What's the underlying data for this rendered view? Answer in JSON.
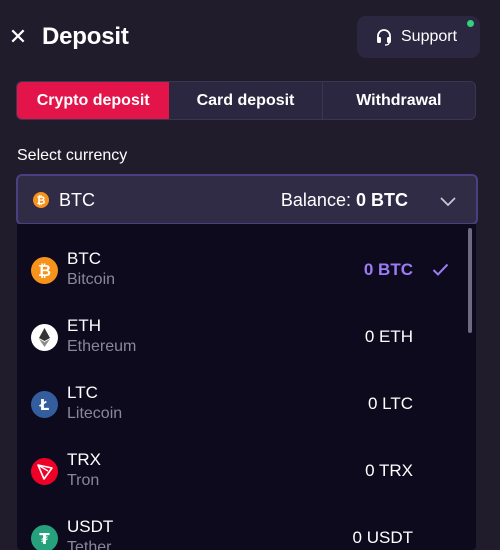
{
  "header": {
    "title": "Deposit",
    "close_icon": "close-icon",
    "support_label": "Support",
    "support_icon": "headset-icon",
    "online_status_color": "#32d17d"
  },
  "tabs": [
    {
      "label": "Crypto deposit",
      "active": true
    },
    {
      "label": "Card deposit",
      "active": false
    },
    {
      "label": "Withdrawal",
      "active": false
    }
  ],
  "currency_select": {
    "label": "Select currency",
    "selected_code": "BTC",
    "balance_label": "Balance:",
    "balance_value": "0 BTC",
    "chevron_icon": "chevron-down-icon"
  },
  "currencies": [
    {
      "code": "BTC",
      "name": "Bitcoin",
      "amount": "0 BTC",
      "selected": true,
      "color": "#f7931a"
    },
    {
      "code": "ETH",
      "name": "Ethereum",
      "amount": "0 ETH",
      "selected": false,
      "color": "#ffffff"
    },
    {
      "code": "LTC",
      "name": "Litecoin",
      "amount": "0 LTC",
      "selected": false,
      "color": "#345d9d"
    },
    {
      "code": "TRX",
      "name": "Tron",
      "amount": "0 TRX",
      "selected": false,
      "color": "#ef0027"
    },
    {
      "code": "USDT",
      "name": "Tether",
      "amount": "0 USDT",
      "selected": false,
      "color": "#26a17b"
    }
  ],
  "colors": {
    "accent": "#e31449",
    "selected_amount": "#9b7cf5",
    "background": "#201c2c"
  }
}
